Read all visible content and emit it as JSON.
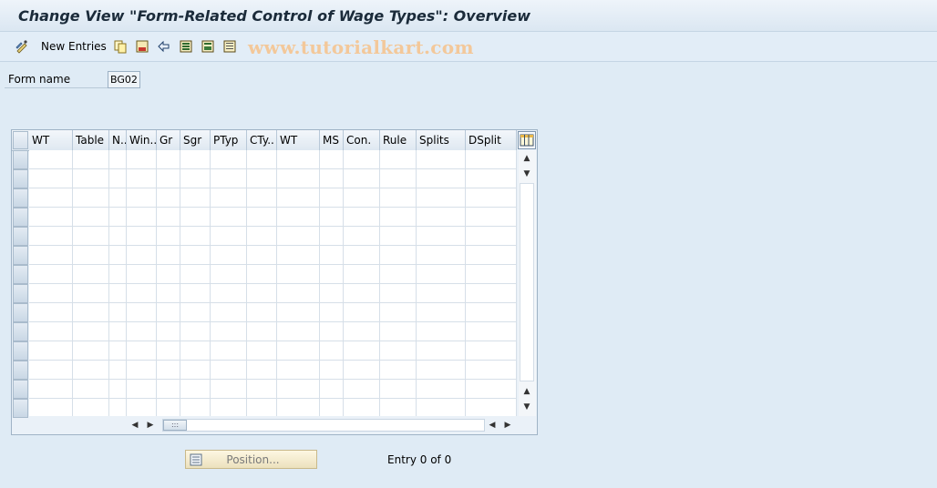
{
  "window": {
    "title": "Change View \"Form-Related Control of Wage Types\": Overview"
  },
  "toolbar": {
    "new_entries_label": "New Entries",
    "icons": [
      "display-change-icon",
      "copy-icon",
      "delete-icon",
      "undo-icon",
      "select-all-icon",
      "select-block-icon",
      "deselect-all-icon"
    ]
  },
  "watermark": "www.tutorialkart.com",
  "form": {
    "label": "Form name",
    "value": "BG02"
  },
  "table": {
    "columns": [
      "WT",
      "Table",
      "N..",
      "Win..",
      "Gr",
      "Sgr",
      "PTyp",
      "CTy..",
      "WT",
      "MS",
      "Con.",
      "Rule",
      "Splits",
      "DSplit"
    ],
    "row_count": 14
  },
  "footer": {
    "position_label": "Position...",
    "entry_text": "Entry 0 of 0"
  }
}
